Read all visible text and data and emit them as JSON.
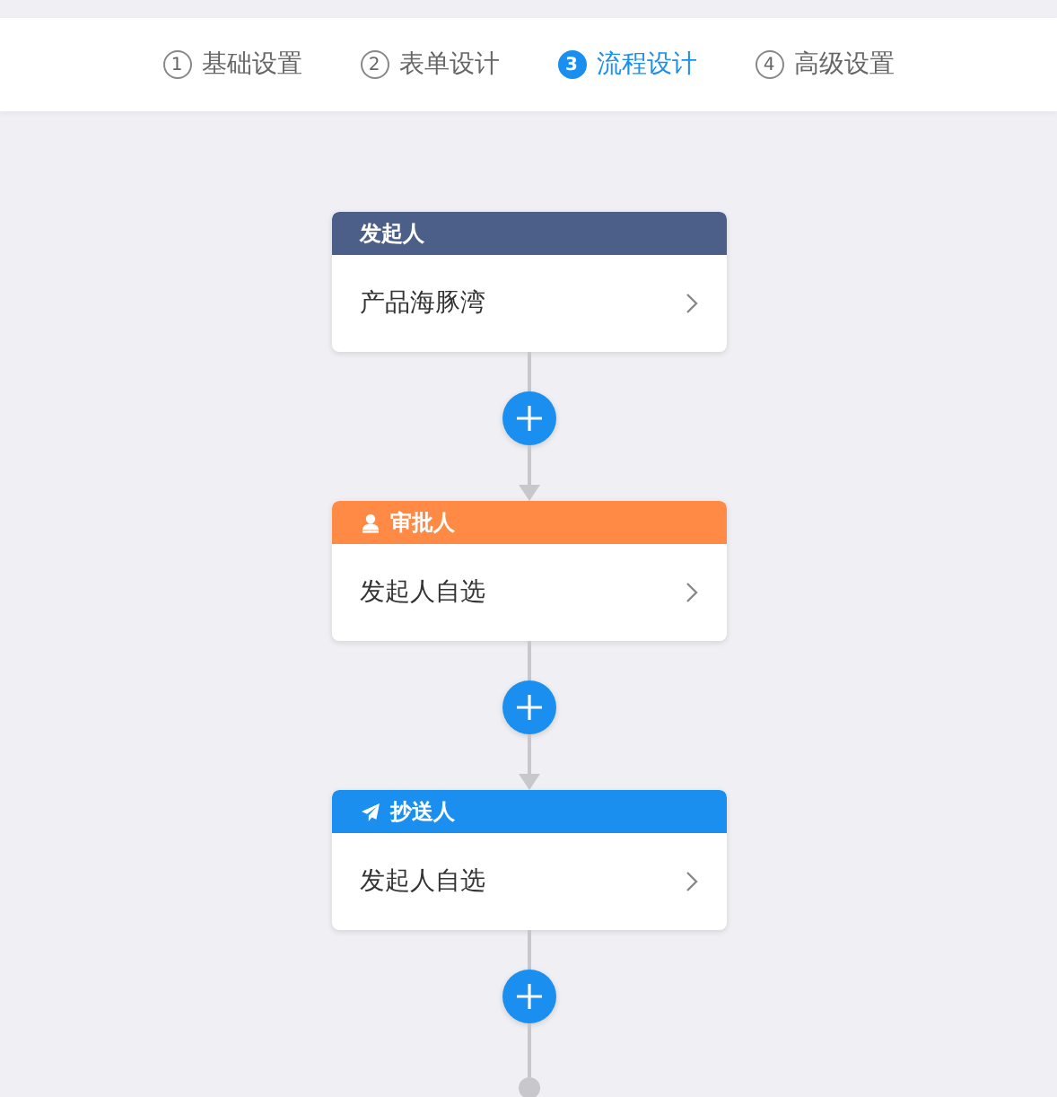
{
  "steps": [
    {
      "number": "1",
      "label": "基础设置",
      "selected": false
    },
    {
      "number": "2",
      "label": "表单设计",
      "selected": false
    },
    {
      "number": "3",
      "label": "流程设计",
      "selected": true
    },
    {
      "number": "4",
      "label": "高级设置",
      "selected": false
    }
  ],
  "nodes": [
    {
      "kind": "start",
      "title": "发起人",
      "color": "#4b5f89",
      "value": "产品海豚湾"
    },
    {
      "kind": "approver",
      "title": "审批人",
      "color": "#ff8a45",
      "value": "发起人自选"
    },
    {
      "kind": "cc",
      "title": "抄送人",
      "color": "#1a8ff0",
      "value": "发起人自选"
    }
  ]
}
